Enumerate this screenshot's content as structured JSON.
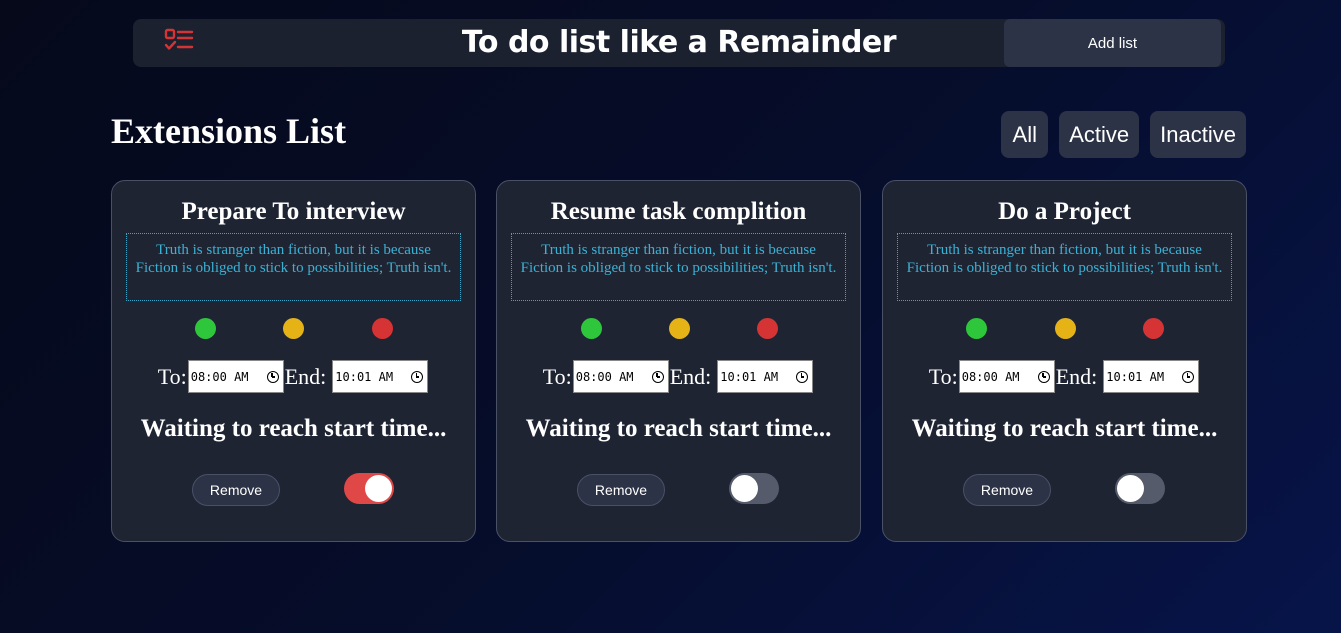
{
  "header": {
    "title": "To do list like a Remainder",
    "add_list_label": "Add list",
    "logo_icon": "checklist-icon",
    "logo_color": "#d63434"
  },
  "section": {
    "title": "Extensions List"
  },
  "filters": [
    {
      "label": "All"
    },
    {
      "label": "Active"
    },
    {
      "label": "Inactive"
    }
  ],
  "cards": [
    {
      "title": "Prepare To interview",
      "description": "Truth is stranger than fiction, but it is because Fiction is obliged to stick to possibilities; Truth isn't.",
      "to_label": "To:",
      "start_time": "08:00 AM",
      "end_label": "End:",
      "end_time": "10:01 AM",
      "status": "Waiting to reach start time...",
      "remove_label": "Remove",
      "enabled": true
    },
    {
      "title": "Resume task complition",
      "description": "Truth is stranger than fiction, but it is because Fiction is obliged to stick to possibilities; Truth isn't.",
      "to_label": "To:",
      "start_time": "08:00 AM",
      "end_label": "End:",
      "end_time": "10:01 AM",
      "status": "Waiting to reach start time...",
      "remove_label": "Remove",
      "enabled": false
    },
    {
      "title": "Do a Project",
      "description": "Truth is stranger than fiction, but it is because Fiction is obliged to stick to possibilities; Truth isn't.",
      "to_label": "To:",
      "start_time": "08:00 AM",
      "end_label": "End:",
      "end_time": "10:01 AM",
      "status": "Waiting to reach start time...",
      "remove_label": "Remove",
      "enabled": false
    }
  ],
  "colors": {
    "status_green": "#2ec73c",
    "status_yellow": "#e6b317",
    "status_red": "#d63434",
    "toggle_on": "#e04848",
    "description_text": "#3bb1d4"
  }
}
